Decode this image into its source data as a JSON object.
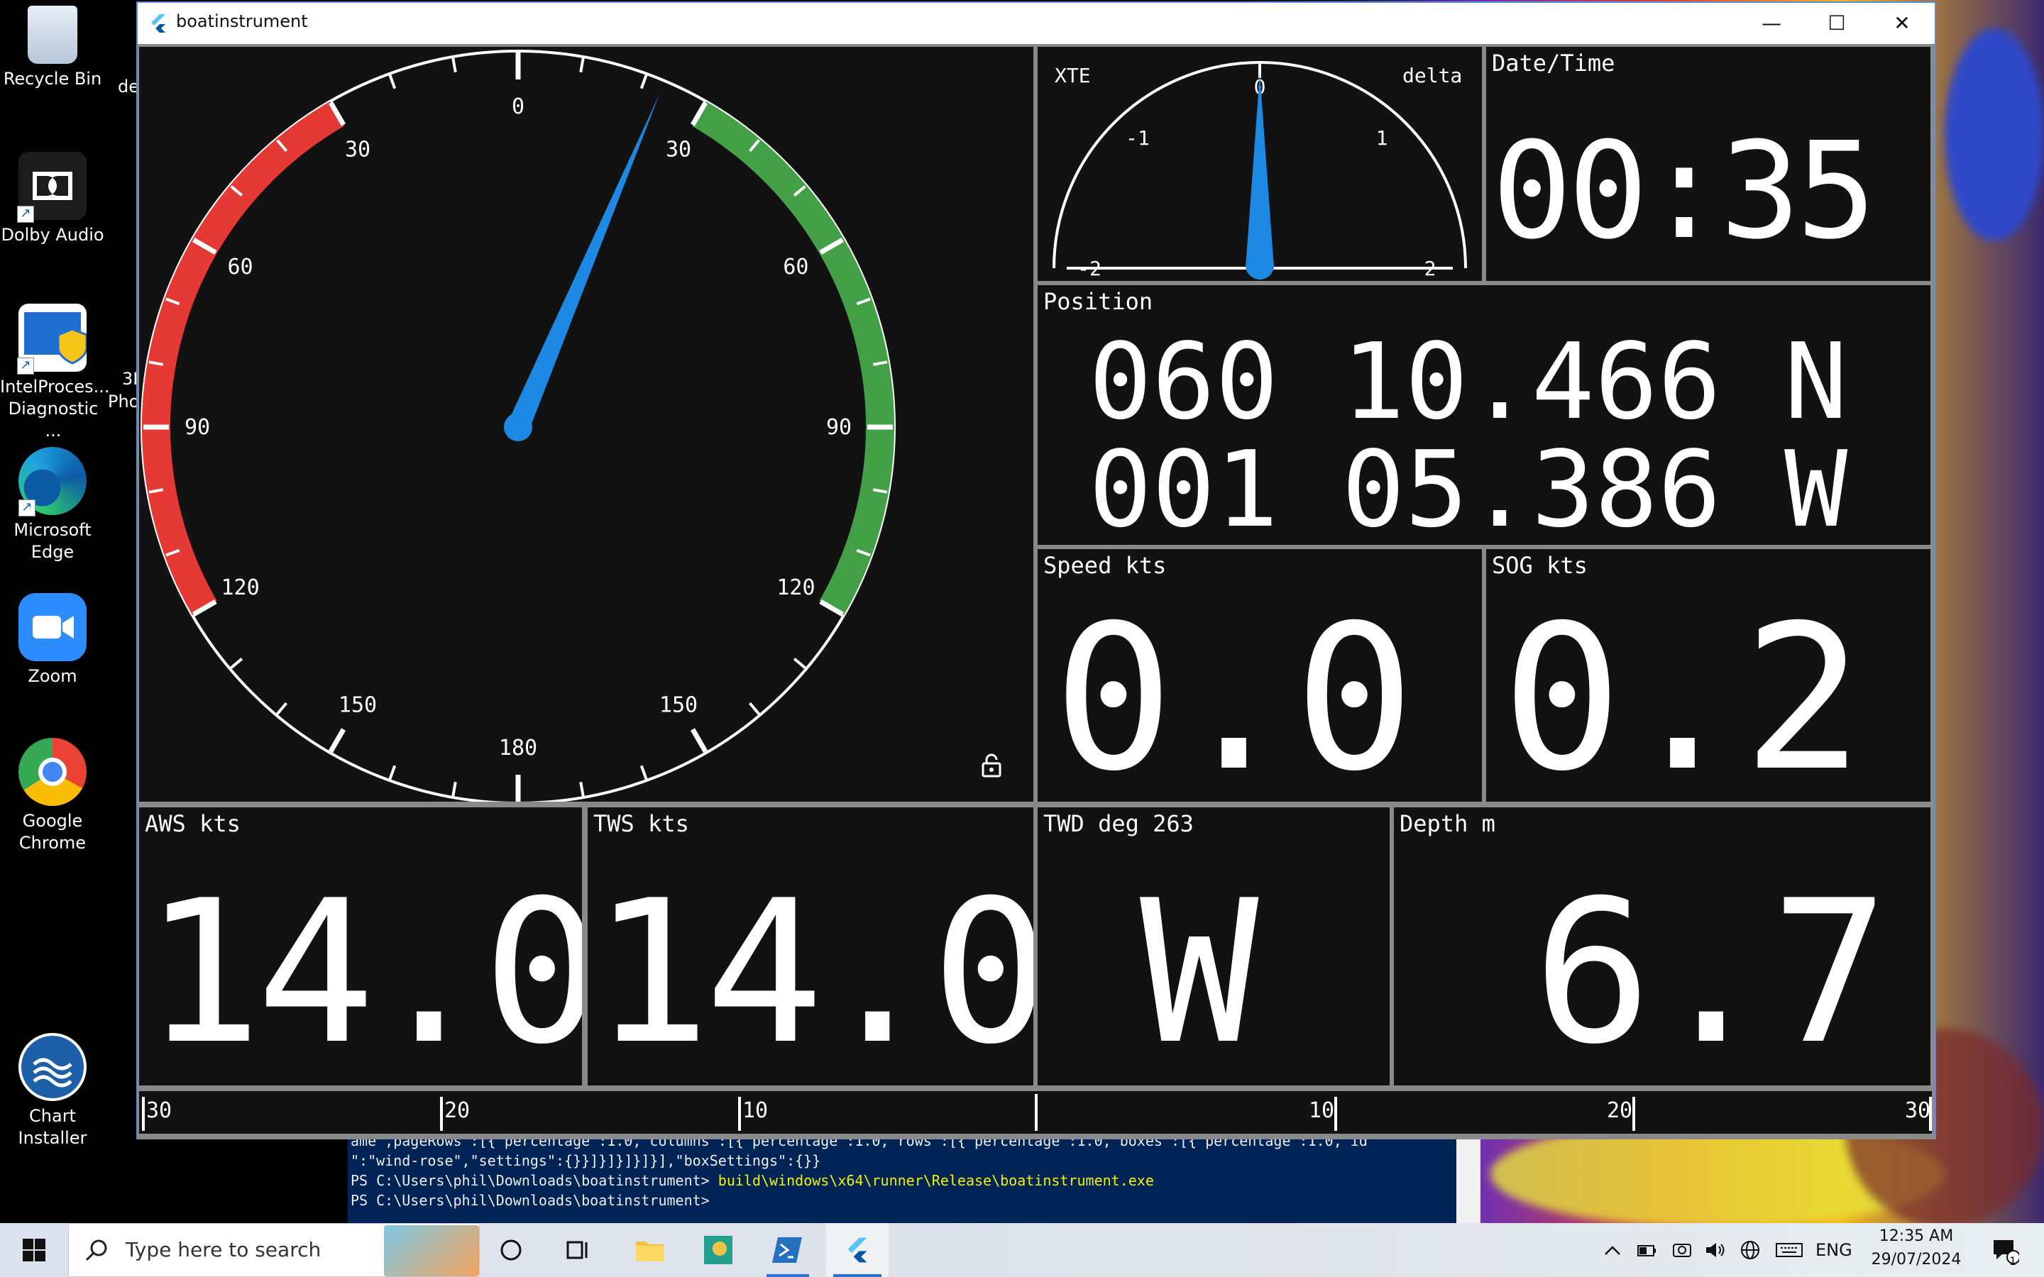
{
  "desktop": {
    "icons": [
      {
        "label": "Recycle Bin"
      },
      {
        "label": "Dolby Audio"
      },
      {
        "label": "IntelProces... Diagnostic ..."
      },
      {
        "label": "Microsoft Edge"
      },
      {
        "label": "Zoom"
      },
      {
        "label": "Google Chrome"
      },
      {
        "label": "Chart Installer"
      }
    ],
    "partial_labels": [
      "de",
      "3I",
      "Pho"
    ]
  },
  "window": {
    "title": "boatinstrument",
    "minimize": "—",
    "maximize": "☐",
    "close": "✕"
  },
  "wind_gauge": {
    "scale_labels": [
      "0",
      "30",
      "30",
      "60",
      "60",
      "90",
      "90",
      "120",
      "120",
      "150",
      "150",
      "180"
    ],
    "needle_angle_deg": 23,
    "lock_icon": "lock-icon",
    "colors": {
      "port": "#e53935",
      "starboard": "#43a047",
      "needle": "#1e88e5"
    }
  },
  "xte": {
    "left_label": "XTE",
    "right_label": "delta",
    "ticks": [
      "0",
      "-1",
      "1",
      "-2",
      "2"
    ],
    "needle_value": 0
  },
  "datetime": {
    "label": "Date/Time",
    "value": "00:35"
  },
  "position": {
    "label": "Position",
    "lat": "060 10.466 N",
    "lon": "001 05.386 W"
  },
  "speed": {
    "label": "Speed kts",
    "value": "0.0"
  },
  "sog": {
    "label": "SOG kts",
    "value": "0.2"
  },
  "aws": {
    "label": "AWS kts",
    "value": "14.0"
  },
  "tws": {
    "label": "TWS kts",
    "value": "14.0"
  },
  "twd": {
    "label": "TWD deg 263",
    "value": "W"
  },
  "depth": {
    "label": "Depth m",
    "value": "6.7"
  },
  "rudder_strip": {
    "labels": [
      "30",
      "20",
      "10",
      "10",
      "20",
      "30"
    ]
  },
  "powershell": {
    "line1": "ame\",pageRows\":[{\"percentage\":1.0,\"columns\":[{\"percentage\":1.0,\"rows\":[{\"percentage\":1.0,\"boxes\":[{\"percentage\":1.0,\"id",
    "line2": "\":\"wind-rose\",\"settings\":{}}]}]}]}]}],\"boxSettings\":{}}",
    "line3_prompt": "PS C:\\Users\\phil\\Downloads\\boatinstrument>",
    "line3_cmd": "build\\windows\\x64\\runner\\Release\\boatinstrument.exe",
    "line4_prompt": "PS C:\\Users\\phil\\Downloads\\boatinstrument>"
  },
  "taskbar": {
    "search_placeholder": "Type here to search",
    "language": "ENG",
    "time": "12:35 AM",
    "date": "29/07/2024",
    "notification_count": "1"
  }
}
